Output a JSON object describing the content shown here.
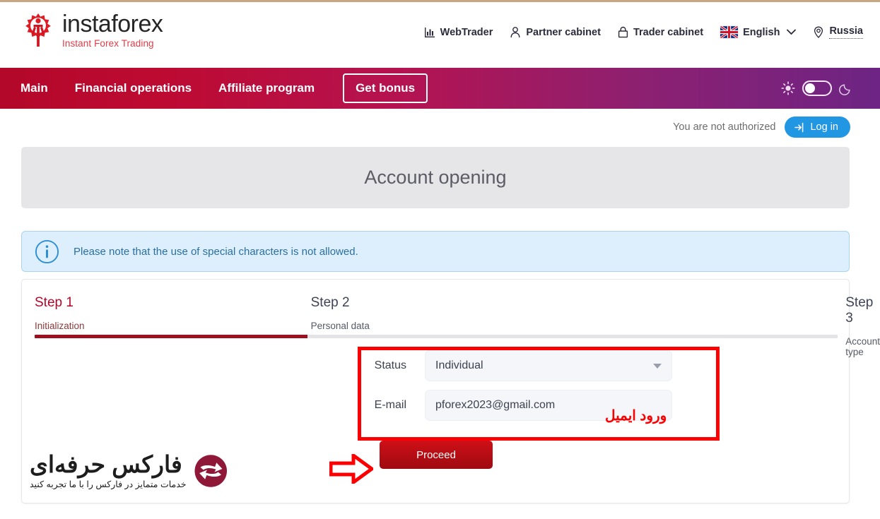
{
  "brand": {
    "name": "instaforex",
    "tagline": "Instant Forex Trading",
    "logo_icon": "instaforex-gear-man-logo"
  },
  "header": {
    "links": [
      {
        "label": "WebTrader",
        "icon": "chart-bars-icon"
      },
      {
        "label": "Partner cabinet",
        "icon": "person-icon"
      },
      {
        "label": "Trader cabinet",
        "icon": "lock-icon"
      }
    ],
    "language": {
      "label": "English",
      "icon": "uk-flag-icon",
      "chevron": "chevron-down-icon"
    },
    "geo": {
      "label": "Russia",
      "icon": "location-pin-icon"
    }
  },
  "main_nav": {
    "items": [
      "Main",
      "Financial operations",
      "Affiliate program"
    ],
    "bonus_label": "Get bonus",
    "theme": {
      "light_icon": "sun-icon",
      "dark_icon": "moon-icon",
      "state": "light"
    },
    "gradient_start": "#b3082a",
    "gradient_end": "#6d2484"
  },
  "auth": {
    "status_text": "You are not authorized",
    "login_label": "Log in",
    "login_icon": "login-arrow-icon",
    "login_color": "#2196e3"
  },
  "page_title": "Account opening",
  "notice": {
    "icon": "info-circle-icon",
    "text": "Please note that the use of special characters is not allowed.",
    "color": "#2a6fa3"
  },
  "steps": [
    {
      "title": "Step 1",
      "subtitle": "Initialization",
      "active": true
    },
    {
      "title": "Step 2",
      "subtitle": "Personal data",
      "active": false
    },
    {
      "title": "Step 3",
      "subtitle": "Account type",
      "active": false
    }
  ],
  "progress_percent": 34,
  "form": {
    "status": {
      "label": "Status",
      "value": "Individual",
      "caret_icon": "chevron-down-icon"
    },
    "email": {
      "label": "E-mail",
      "value": "pforex2023@gmail.com",
      "placeholder": "E-mail"
    },
    "submit_label": "Proceed",
    "submit_color": "#cf0f17"
  },
  "watermark": {
    "title": "فارکس حرفه‌ای",
    "subtitle": "خدمات متمایز در فارکس را با ما تجربه کنید",
    "logo_icon": "pforex-s-circle-logo"
  },
  "annotations": {
    "highlight_color": "#fb0000",
    "email_note": "ورود ایمیل",
    "arrow_icon": "right-arrow-annotation-icon",
    "box_icon": "red-highlight-box"
  }
}
